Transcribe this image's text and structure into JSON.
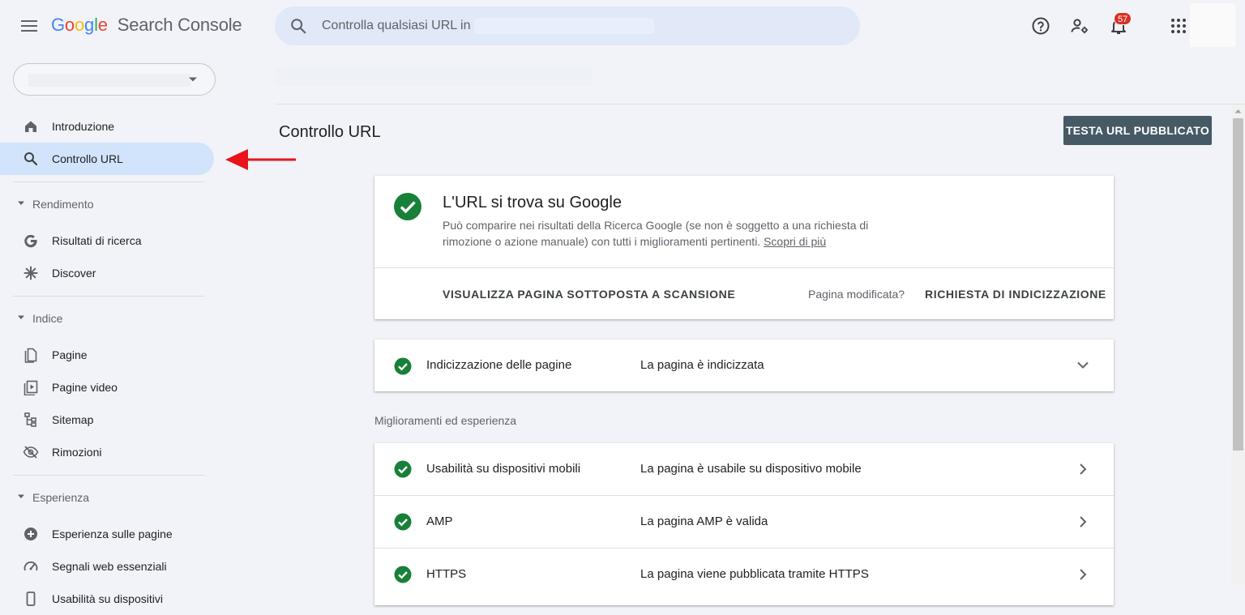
{
  "app": {
    "logo_google": [
      "G",
      "o",
      "o",
      "g",
      "l",
      "e"
    ],
    "logo_colors": [
      "#4285F4",
      "#EA4335",
      "#FBBC05",
      "#4285F4",
      "#34A853",
      "#EA4335"
    ],
    "logo_product": "Search Console"
  },
  "search": {
    "placeholder": "Controlla qualsiasi URL in"
  },
  "topbar": {
    "notifications_count": "57"
  },
  "sidebar": {
    "items": [
      {
        "label": "Introduzione",
        "icon": "home-icon"
      },
      {
        "label": "Controllo URL",
        "icon": "search-icon",
        "active": true
      }
    ],
    "sections": [
      {
        "label": "Rendimento",
        "items": [
          {
            "label": "Risultati di ricerca",
            "icon": "google-g-icon"
          },
          {
            "label": "Discover",
            "icon": "asterisk-icon"
          }
        ]
      },
      {
        "label": "Indice",
        "items": [
          {
            "label": "Pagine",
            "icon": "pages-icon"
          },
          {
            "label": "Pagine video",
            "icon": "video-page-icon"
          },
          {
            "label": "Sitemap",
            "icon": "sitemap-icon"
          },
          {
            "label": "Rimozioni",
            "icon": "eye-off-icon"
          }
        ]
      },
      {
        "label": "Esperienza",
        "items": [
          {
            "label": "Esperienza sulle pagine",
            "icon": "plus-circle-icon"
          },
          {
            "label": "Segnali web essenziali",
            "icon": "speed-gauge-icon"
          },
          {
            "label": "Usabilità su dispositivi",
            "icon": "phone-icon"
          }
        ]
      }
    ]
  },
  "main": {
    "title": "Controllo URL",
    "test_button": "TESTA URL PUBBLICATO",
    "status": {
      "heading": "L'URL si trova su Google",
      "description": "Può comparire nei risultati della Ricerca Google (se non è soggetto a una richiesta di rimozione o azione manuale) con tutti i miglioramenti pertinenti.",
      "learn_more": "Scopri di più",
      "view_crawled": "VISUALIZZA PAGINA SOTTOPOSTA A SCANSIONE",
      "page_changed": "Pagina modificata?",
      "request_indexing": "RICHIESTA DI INDICIZZAZIONE"
    },
    "indexing": {
      "label": "Indicizzazione delle pagine",
      "value": "La pagina è indicizzata"
    },
    "enhancements_heading": "Miglioramenti ed esperienza",
    "enhancements": [
      {
        "label": "Usabilità su dispositivi mobili",
        "value": "La pagina è usabile su dispositivo mobile"
      },
      {
        "label": "AMP",
        "value": "La pagina AMP è valida"
      },
      {
        "label": "HTTPS",
        "value": "La pagina viene pubblicata tramite HTTPS"
      }
    ]
  },
  "colors": {
    "accent_green": "#188038",
    "active_nav": "#d2e3fc",
    "button": "#455a64",
    "badge": "#d93025",
    "arrow": "#e8131b"
  }
}
